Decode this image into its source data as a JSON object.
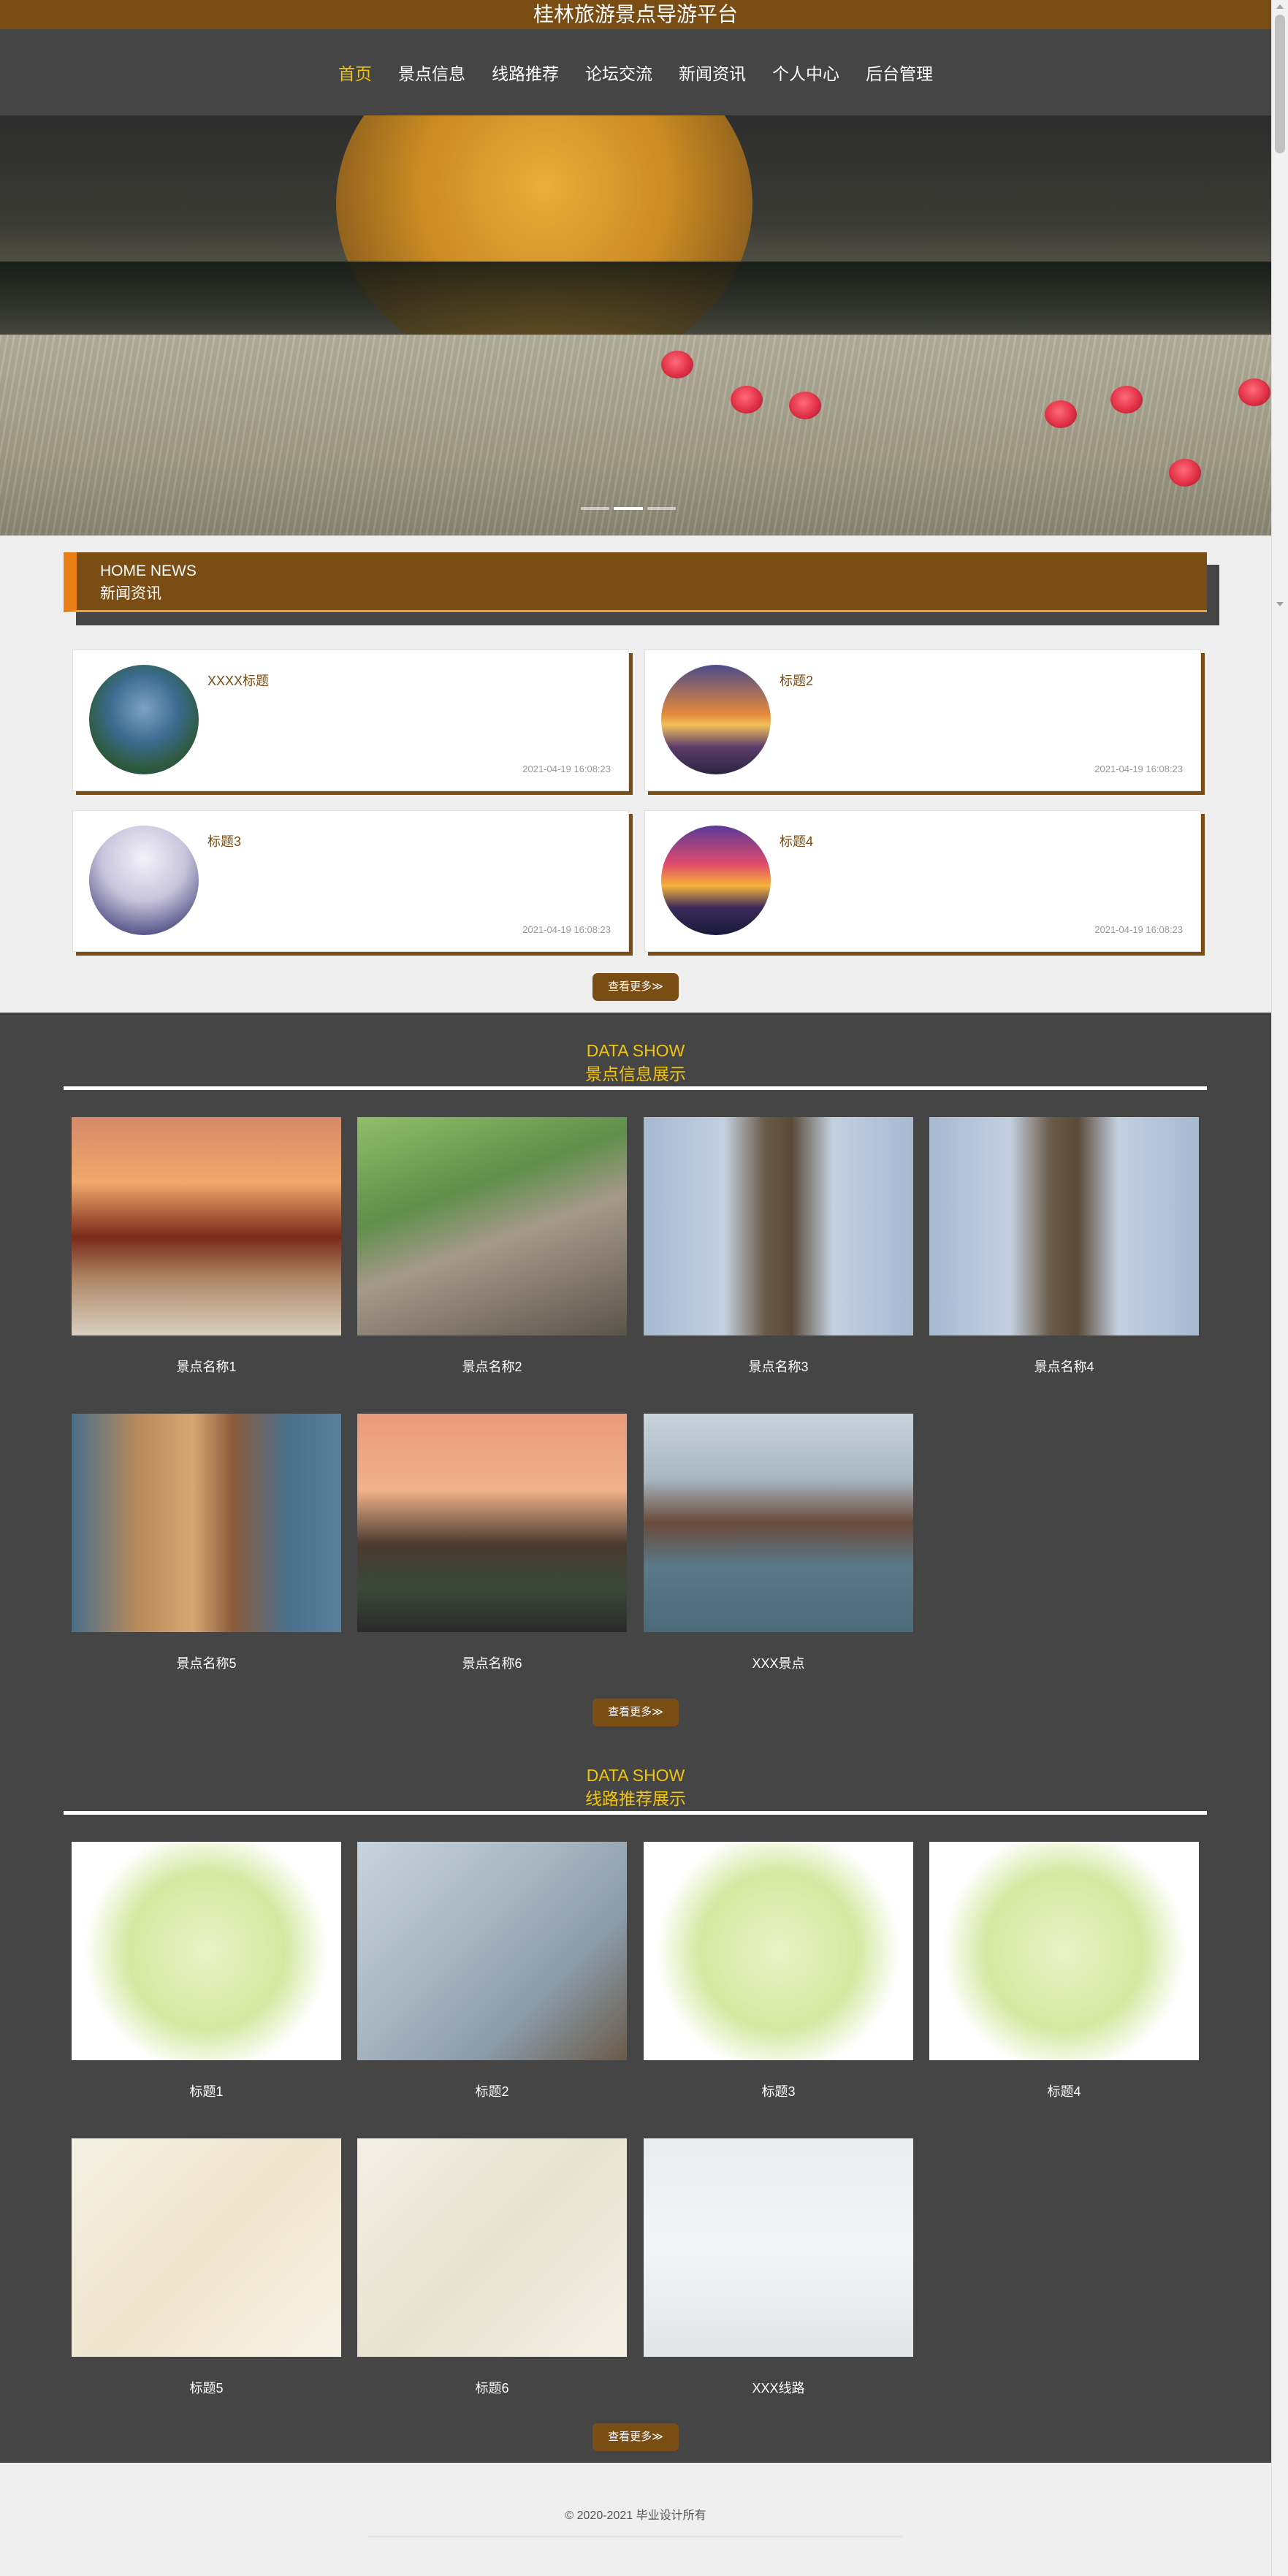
{
  "header": {
    "title": "桂林旅游景点导游平台"
  },
  "nav": {
    "items": [
      "首页",
      "景点信息",
      "线路推荐",
      "论坛交流",
      "新闻资讯",
      "个人中心",
      "后台管理"
    ],
    "active": "首页",
    "active_color": "#f1c40f"
  },
  "news_section": {
    "en": "HOME NEWS",
    "cn": "新闻资讯",
    "items": [
      {
        "title": "XXXX标题",
        "time": "2021-04-19 16:08:23"
      },
      {
        "title": "标题2",
        "time": "2021-04-19 16:08:23"
      },
      {
        "title": "标题3",
        "time": "2021-04-19 16:08:23"
      },
      {
        "title": "标题4",
        "time": "2021-04-19 16:08:23"
      }
    ],
    "more": "查看更多≫"
  },
  "spots_section": {
    "en": "DATA SHOW",
    "cn": "景点信息展示",
    "items": [
      "景点名称1",
      "景点名称2",
      "景点名称3",
      "景点名称4",
      "景点名称5",
      "景点名称6",
      "XXX景点"
    ],
    "more": "查看更多≫"
  },
  "routes_section": {
    "en": "DATA SHOW",
    "cn": "线路推荐展示",
    "items": [
      "标题1",
      "标题2",
      "标题3",
      "标题4",
      "标题5",
      "标题6",
      "XXX线路"
    ],
    "more": "查看更多≫"
  },
  "footer": {
    "copyright": "© 2020-2021 毕业设计所有"
  },
  "colors": {
    "brand": "#7a4d14",
    "accent": "#ea7d14",
    "dark": "#454545"
  }
}
